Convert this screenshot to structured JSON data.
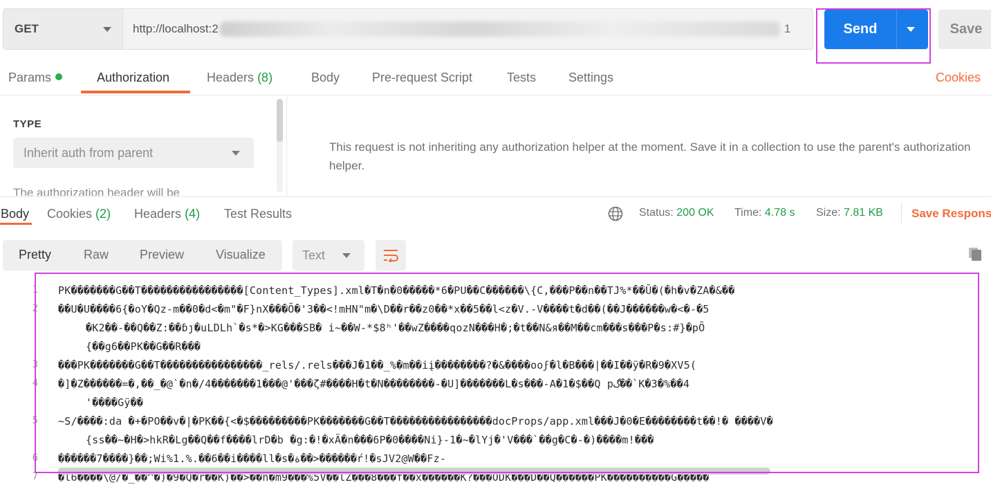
{
  "request": {
    "method": "GET",
    "url_visible_prefix": "http://localhost:2",
    "url_visible_suffix": "1",
    "send_label": "Send",
    "save_label": "Save"
  },
  "request_tabs": {
    "params": "Params",
    "authorization": "Authorization",
    "headers": "Headers",
    "headers_count": "(8)",
    "body": "Body",
    "pre_request_script": "Pre-request Script",
    "tests": "Tests",
    "settings": "Settings",
    "cookies": "Cookies"
  },
  "auth": {
    "type_label": "TYPE",
    "type_value": "Inherit auth from parent",
    "note_partial": "The authorization header will be",
    "message": "This request is not inheriting any authorization helper at the moment. Save it in a collection to use the parent's authorization helper."
  },
  "response_tabs": {
    "body": "Body",
    "cookies": "Cookies",
    "cookies_count": "(2)",
    "headers": "Headers",
    "headers_count": "(4)",
    "test_results": "Test Results"
  },
  "response_stats": {
    "status_label": "Status:",
    "status_value": "200 OK",
    "time_label": "Time:",
    "time_value": "4.78 s",
    "size_label": "Size:",
    "size_value": "7.81 KB",
    "save_response": "Save Respons"
  },
  "view": {
    "pretty": "Pretty",
    "raw": "Raw",
    "preview": "Preview",
    "visualize": "Visualize",
    "format": "Text"
  },
  "code": {
    "line_numbers": [
      "1",
      "2",
      "3",
      "4",
      "5",
      "6",
      "7"
    ],
    "lines": [
      "PK�������G��T����������������[Content_Types].xml�T�n�0�����*6�PU��C������\\{C,���P��n��TJ%*��Ŭ�(�h�v�ZA�&��",
      "��U�U����6{�oY�Qz-m��0�d<�m\"�F}nX���Õ�'3��<!mHN\"m�\\D��r��z0��*x��5��l<z�V.-V����t�d��(��J������w�<�-�5",
      "�K2��-��Q��Z:��ɓȷ�uLDLh`�s*�>KG���SB� i~��W-*$8ʰ'��wZ����qozN���H�;�t��N&я��M��cm���s���P�s:#}�pÕ",
      "{��g6��PK��G��R���",
      "���PK�������G��T����������������_rels/.rels���J�1��_%�m��iį��������?�&����ooϝ�l�B���|��I��ÿ�R�9�XV5(",
      "�]�Z������=�,��_�@`�n�/4�������1���@'���ζ#����H�t�N��������-�U]�������L�s���-A�1�$��Q pگ��`K�3�%��4",
      "'����Gÿ��",
      "~S/����:da �+�PO��v�|�PK��{<�$���������PK�������G��T����������������docProps/app.xml���J�0�E��������t��!� ����V�",
      "{ss��~�H�>hkR�Lg��Q��f����lrD�b �g:�!�xÄ�n���6P�0����Ni}-1�~�lYj�'V���`��g�C�-�)����m!���",
      "������7����}��;Wi%1.%.��6��i����ll�s�ة��>������ŕ!�sJV2@W��Fz-",
      "�l6����\\@/�_��^�)�9�Q�r��K)��>��n�m9���%5V��lZ���8���f��x������K?���ODK���D��Q������PK����������G�����"
    ]
  }
}
